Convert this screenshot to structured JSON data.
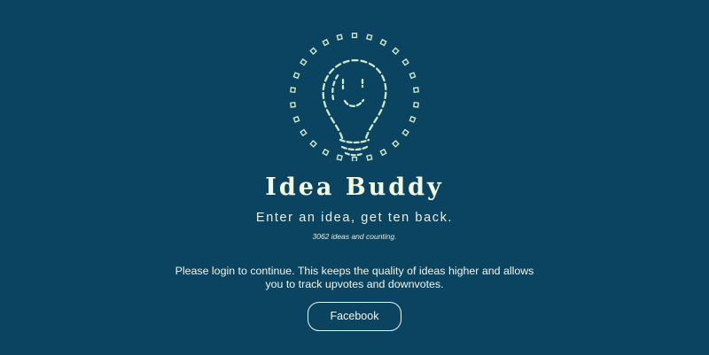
{
  "app": {
    "title": "Idea Buddy",
    "tagline": "Enter an idea, get ten back.",
    "counter_text": "3062 ideas and counting."
  },
  "login": {
    "message": "Please login to continue. This keeps the quality of ideas higher and allows you to track upvotes and downvotes.",
    "facebook_label": "Facebook"
  },
  "icons": {
    "logo": "lightbulb-smile-icon"
  },
  "colors": {
    "background": "#0b4460",
    "text": "#f2f7e0",
    "logo_stroke": "#cfe8c8"
  }
}
